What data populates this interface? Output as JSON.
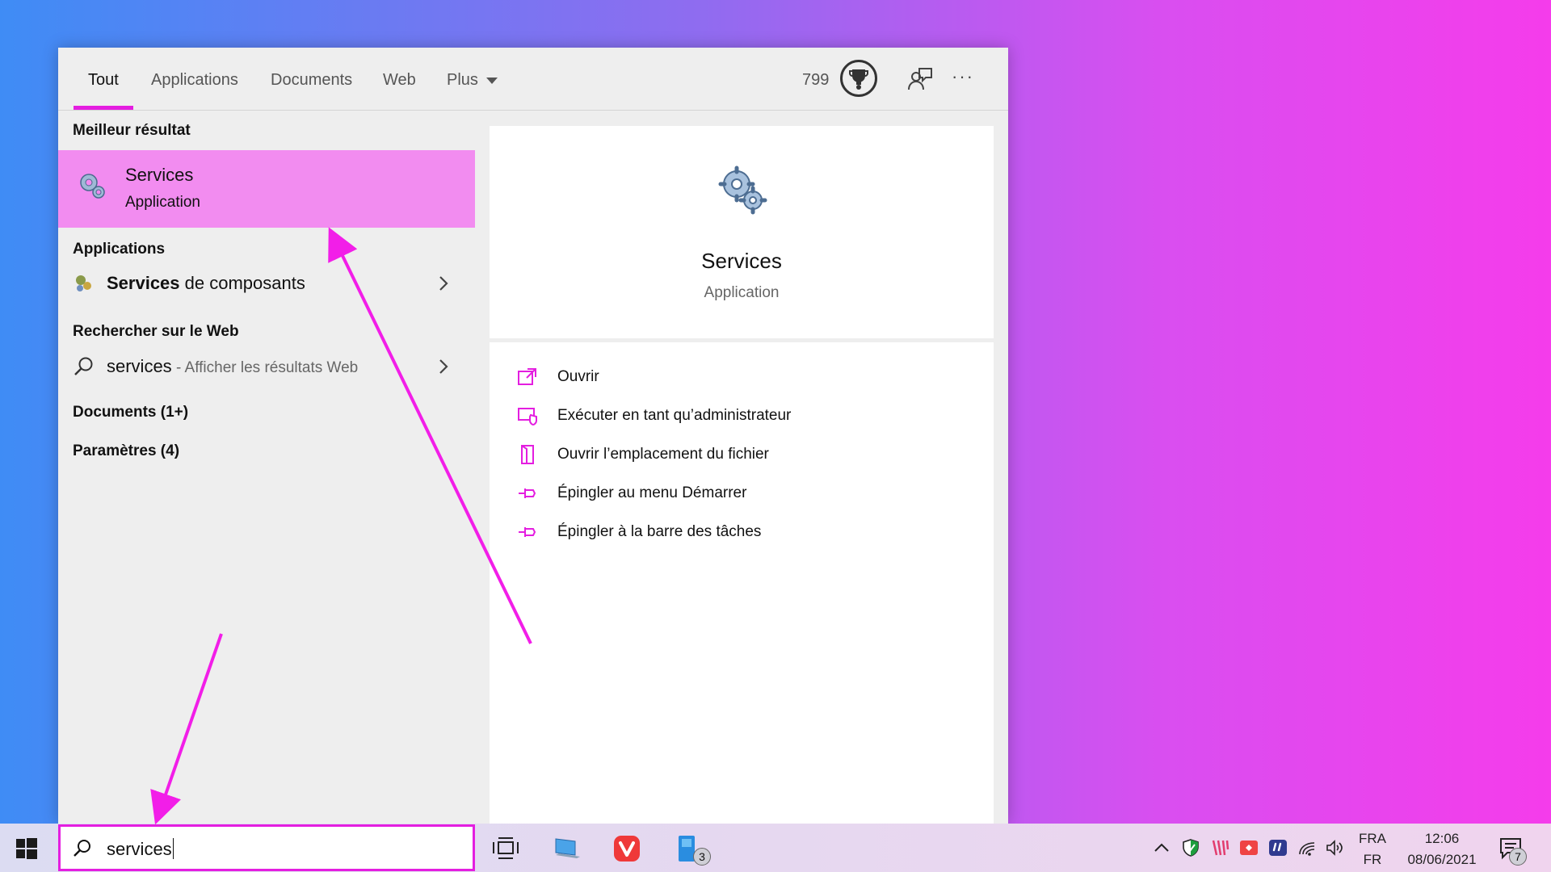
{
  "tabs": [
    {
      "label": "Tout",
      "active": true
    },
    {
      "label": "Applications"
    },
    {
      "label": "Documents"
    },
    {
      "label": "Web"
    },
    {
      "label": "Plus"
    }
  ],
  "header": {
    "points": "799",
    "trophy_icon": "trophy-icon",
    "feedback_icon": "feedback-icon",
    "more_icon": "more-options-icon",
    "more_glyph": "···"
  },
  "results": {
    "best_title": "Meilleur résultat",
    "best": {
      "name": "Services",
      "type": "Application",
      "icon": "services-gear-icon"
    },
    "apps_title": "Applications",
    "app_item": {
      "bold": "Services",
      "rest": " de composants",
      "icon": "component-services-icon"
    },
    "web_title": "Rechercher sur le Web",
    "web_item": {
      "query": "services",
      "suffix": " - Afficher les résultats Web",
      "icon": "search-icon"
    },
    "documents": "Documents (1+)",
    "settings": "Paramètres (4)"
  },
  "preview": {
    "name": "Services",
    "type": "Application",
    "actions": [
      {
        "label": "Ouvrir",
        "icon": "open-icon"
      },
      {
        "label": "Exécuter en tant qu’administrateur",
        "icon": "run-as-admin-icon"
      },
      {
        "label": "Ouvrir l’emplacement du fichier",
        "icon": "file-location-icon"
      },
      {
        "label": "Épingler au menu Démarrer",
        "icon": "pin-icon"
      },
      {
        "label": "Épingler à la barre des tâches",
        "icon": "pin-icon"
      }
    ]
  },
  "taskbar": {
    "search_value": "services",
    "store_badge": "3",
    "lang_top": "FRA",
    "lang_bottom": "FR",
    "time": "12:06",
    "date": "08/06/2021",
    "notif_count": "7"
  },
  "colors": {
    "accent": "#e41ee0",
    "selection": "#f28cf0"
  }
}
